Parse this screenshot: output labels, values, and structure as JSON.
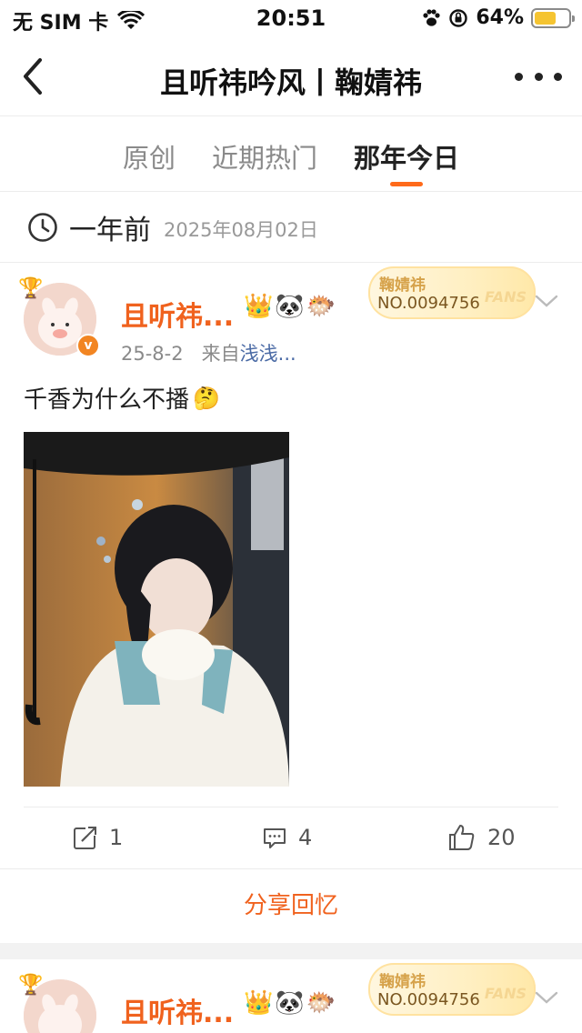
{
  "status_bar": {
    "carrier": "无 SIM 卡",
    "time": "20:51",
    "battery": "64%",
    "battery_level": 0.64,
    "icons": [
      "wifi-icon",
      "paw-icon",
      "orientation-lock-icon",
      "battery-icon"
    ]
  },
  "header": {
    "title": "且听祎吟风丨鞠婧祎",
    "icons": [
      "back-arrow-icon",
      "more-dots-icon"
    ]
  },
  "tabs": [
    {
      "label": "原创",
      "active": false
    },
    {
      "label": "近期热门",
      "active": false
    },
    {
      "label": "那年今日",
      "active": true
    }
  ],
  "time_row": {
    "label": "一年前",
    "date": "2025年08月02日",
    "icon": "clock-icon"
  },
  "posts": [
    {
      "user_name": "且听祎...",
      "badges": [
        "crown-emoji-icon",
        "panda-emoji-icon",
        "fish-emoji-icon"
      ],
      "fans_card": {
        "name": "鞠婧祎",
        "number": "NO.0094756",
        "word": "FANS"
      },
      "meta_date": "25-8-2",
      "meta_from": "来自",
      "meta_source": "浅浅...",
      "text": "千香为什么不播",
      "text_emoji": "thinking-face-icon",
      "actions": {
        "repost": "1",
        "comment": "4",
        "like": "20"
      },
      "share_label": "分享回忆"
    },
    {
      "user_name": "且听祎...",
      "badges": [
        "crown-emoji-icon",
        "panda-emoji-icon",
        "fish-emoji-icon"
      ],
      "fans_card": {
        "name": "鞠婧祎",
        "number": "NO.0094756",
        "word": "FANS"
      }
    }
  ],
  "colors": {
    "accent": "#f0621e",
    "tab_underline": "#ff6a1a",
    "link": "#4a6aa5",
    "battery": "#f5c431"
  }
}
